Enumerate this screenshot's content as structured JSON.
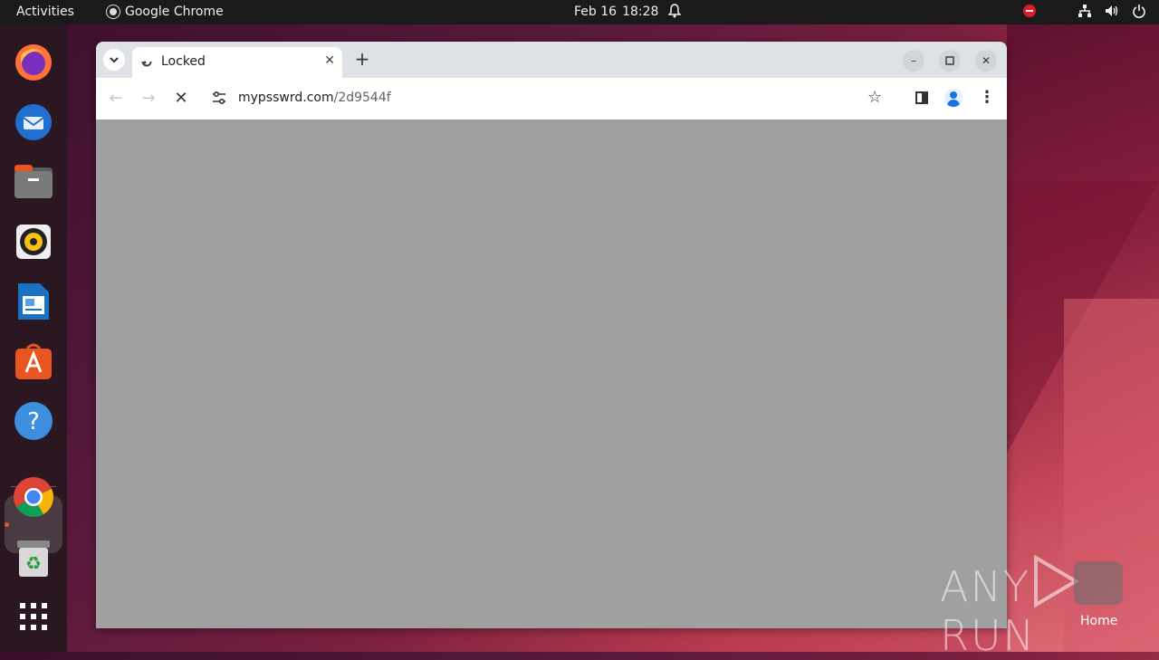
{
  "topbar": {
    "activities": "Activities",
    "app_name": "Google Chrome",
    "date": "Feb 16",
    "time": "18:28"
  },
  "dock": {
    "items": [
      {
        "name": "Firefox",
        "icon": "firefox-icon"
      },
      {
        "name": "Thunderbird",
        "icon": "thunderbird-icon"
      },
      {
        "name": "Files",
        "icon": "files-icon"
      },
      {
        "name": "Rhythmbox",
        "icon": "rhythmbox-icon"
      },
      {
        "name": "LibreOffice Writer",
        "icon": "writer-icon"
      },
      {
        "name": "Ubuntu Software",
        "icon": "software-icon"
      },
      {
        "name": "Help",
        "icon": "help-icon"
      },
      {
        "name": "Google Chrome",
        "icon": "chrome-icon"
      },
      {
        "name": "Trash",
        "icon": "trash-icon"
      },
      {
        "name": "Show Applications",
        "icon": "apps-grid-icon"
      }
    ]
  },
  "browser": {
    "tab": {
      "title": "Locked"
    },
    "url": {
      "host": "mypsswrd.com",
      "path": "/2d9544f"
    }
  },
  "desktop": {
    "home_label": "Home",
    "watermark": "ANY RUN"
  },
  "colors": {
    "content_bg": "#a0a0a0",
    "accent": "#e95420"
  }
}
